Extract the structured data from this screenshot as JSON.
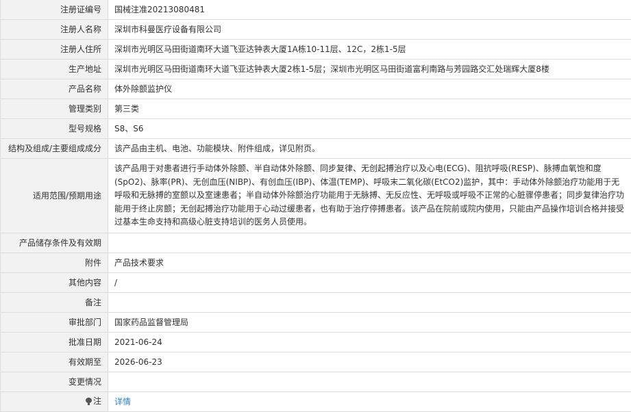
{
  "rows": [
    {
      "label": "注册证编号",
      "value": "国械注准20213080481"
    },
    {
      "label": "注册人名称",
      "value": "深圳市科曼医疗设备有限公司"
    },
    {
      "label": "注册人住所",
      "value": "深圳市光明区马田街道南环大道飞亚达钟表大厦1A栋10-11层、12C，2栋1-5层"
    },
    {
      "label": "生产地址",
      "value": "深圳市光明区马田街道南环大道飞亚达钟表大厦2栋1-5层；深圳市光明区马田街道富利南路与芳园路交汇处瑞辉大厦8楼"
    },
    {
      "label": "产品名称",
      "value": "体外除颤监护仪"
    },
    {
      "label": "管理类别",
      "value": "第三类"
    },
    {
      "label": "型号规格",
      "value": "S8、S6"
    },
    {
      "label": "结构及组成/主要组成成分",
      "value": "该产品由主机、电池、功能模块、附件组成，详见附页。"
    },
    {
      "label": "适用范围/预期用途",
      "value": "该产品用于对患者进行手动体外除颤、半自动体外除颤、同步复律、无创起搏治疗以及心电(ECG)、阻抗呼吸(RESP)、脉搏血氧饱和度(SpO2)、脉率(PR)、无创血压(NIBP)、有创血压(IBP)、体温(TEMP)、呼吸末二氧化碳(EtCO2)监护，其中：手动体外除颤治疗功能用于无呼吸和无脉搏的室颤以及室速患者；半自动体外除颤治疗功能用于无脉搏、无反应性、无呼吸或呼吸不正常的心脏骤停患者；同步复律治疗功能用于终止房颤；无创起搏治疗功能用于心动过缓患者，也有助于治疗停搏患者。该产品在院前或院内使用，只能由产品操作培训合格并接受过基本生命支持和高级心脏支持培训的医务人员使用。"
    },
    {
      "label": "产品储存条件及有效期",
      "value": ""
    },
    {
      "label": "附件",
      "value": "产品技术要求"
    },
    {
      "label": "其他内容",
      "value": "/"
    },
    {
      "label": "备注",
      "value": ""
    },
    {
      "label": "审批部门",
      "value": "国家药品监督管理局"
    },
    {
      "label": "批准日期",
      "value": "2021-06-24"
    },
    {
      "label": "有效期至",
      "value": "2026-06-23"
    },
    {
      "label": "变更情况",
      "value": ""
    }
  ],
  "note_row": {
    "label": "注",
    "link_text": "详情",
    "icon": "lightbulb-icon"
  },
  "colors": {
    "label_bg": "#f2f2f2",
    "border": "#dcdcdc",
    "link": "#2a84d6"
  }
}
